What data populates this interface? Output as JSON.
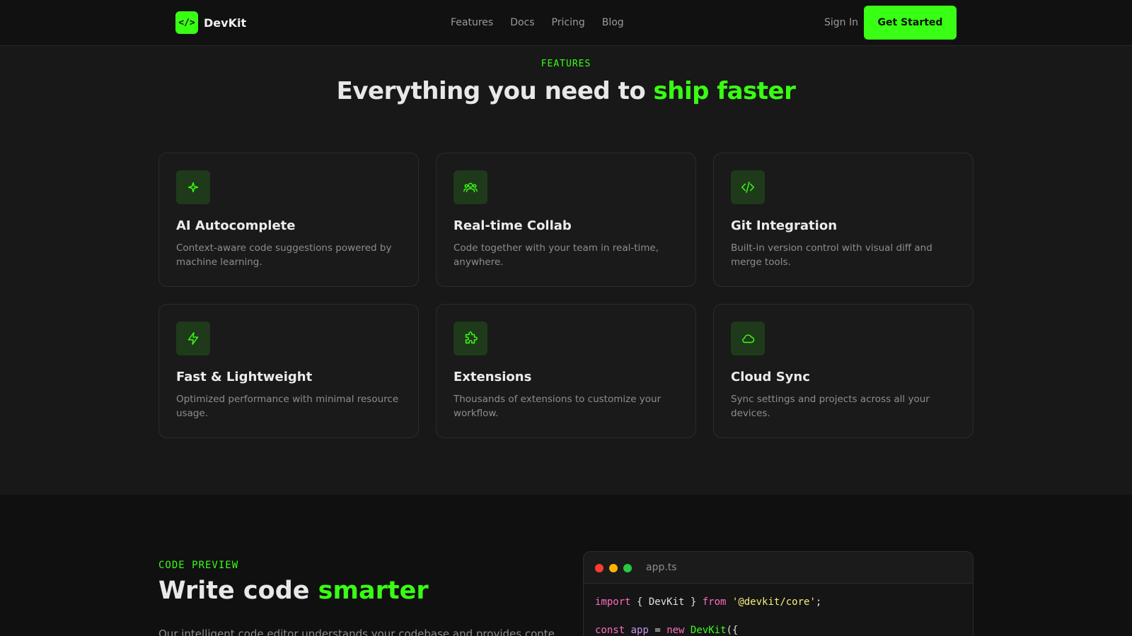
{
  "nav": {
    "logo_mark": "</>",
    "logo_text": "DevKit",
    "links": [
      "Features",
      "Docs",
      "Pricing",
      "Blog"
    ],
    "sign_in": "Sign In",
    "cta": "Get Started"
  },
  "features": {
    "eyebrow": "FEATURES",
    "title_plain": "Everything you need to ",
    "title_accent": "ship faster",
    "cards": [
      {
        "icon": "sparkle-icon",
        "title": "AI Autocomplete",
        "desc": "Context-aware code suggestions powered by machine learning."
      },
      {
        "icon": "users-icon",
        "title": "Real-time Collab",
        "desc": "Code together with your team in real-time, anywhere."
      },
      {
        "icon": "code-icon",
        "title": "Git Integration",
        "desc": "Built-in version control with visual diff and merge tools."
      },
      {
        "icon": "lightning-icon",
        "title": "Fast & Lightweight",
        "desc": "Optimized performance with minimal resource usage."
      },
      {
        "icon": "puzzle-icon",
        "title": "Extensions",
        "desc": "Thousands of extensions to customize your workflow."
      },
      {
        "icon": "cloud-icon",
        "title": "Cloud Sync",
        "desc": "Sync settings and projects across all your devices."
      }
    ]
  },
  "code_preview": {
    "eyebrow": "CODE PREVIEW",
    "title_plain": "Write code ",
    "title_accent": "smarter",
    "body": "Our intelligent code editor understands your codebase and provides context-",
    "file_name": "app.ts",
    "lines": {
      "l1": {
        "kw1": "import",
        "t1": " { DevKit } ",
        "kw2": "from",
        "t2": " ",
        "str": "'@devkit/core'",
        "t3": ";"
      },
      "l2": {
        "kw1": "const",
        "t1": " ",
        "var": "app",
        "t2": " = ",
        "kw2": "new",
        "t3": " ",
        "cls": "DevKit",
        "t4": "({"
      }
    }
  },
  "colors": {
    "accent": "#39ff14",
    "background": "#181818",
    "nav_background": "#111111"
  }
}
